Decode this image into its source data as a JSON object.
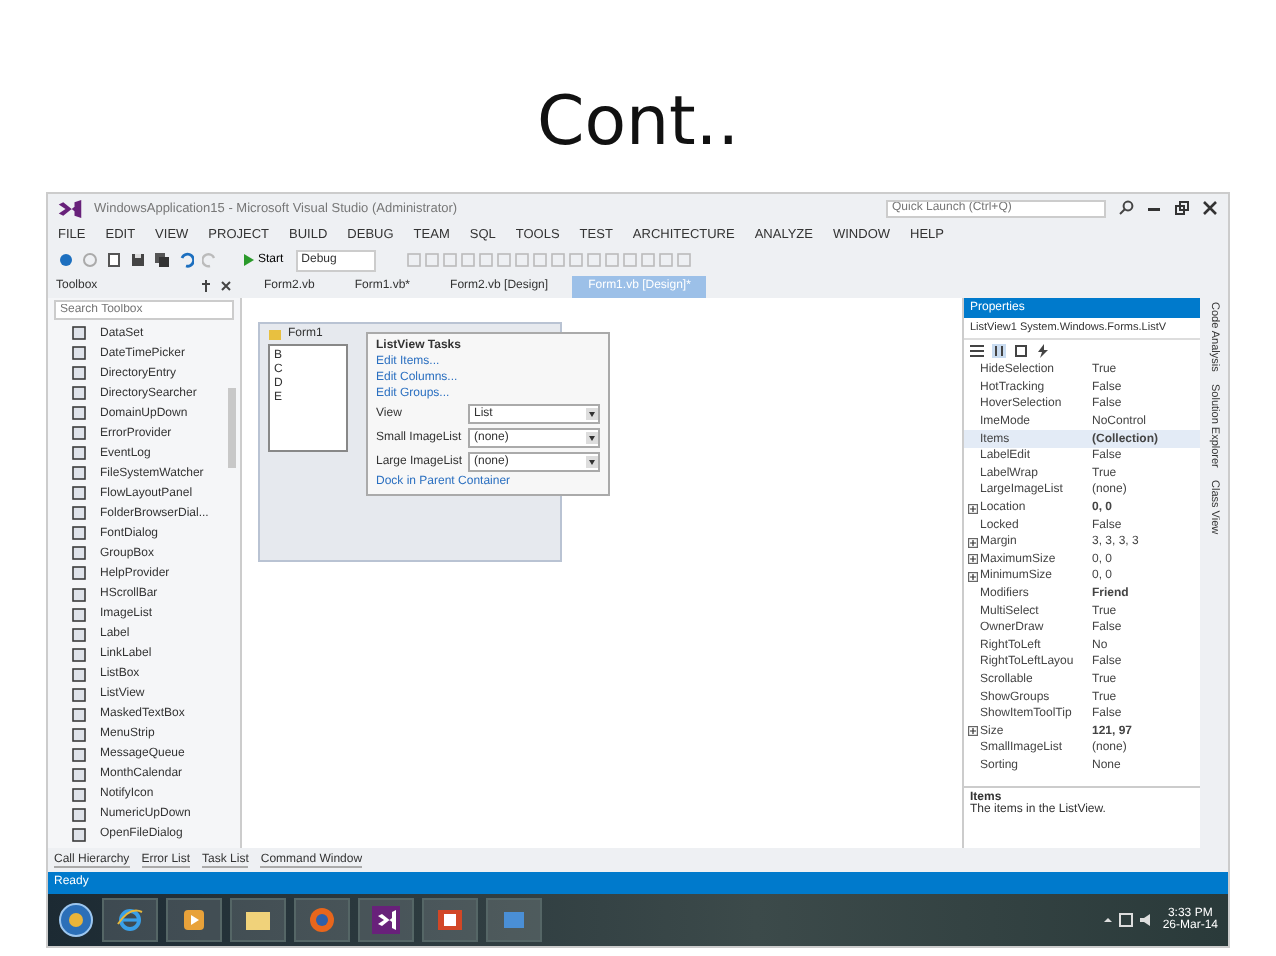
{
  "slide": {
    "title": "Cont.."
  },
  "window": {
    "title": "WindowsApplication15 - Microsoft Visual Studio (Administrator)",
    "quick_launch": {
      "placeholder": "Quick Launch (Ctrl+Q)"
    }
  },
  "menu": [
    "FILE",
    "EDIT",
    "VIEW",
    "PROJECT",
    "BUILD",
    "DEBUG",
    "TEAM",
    "SQL",
    "TOOLS",
    "TEST",
    "ARCHITECTURE",
    "ANALYZE",
    "WINDOW",
    "HELP"
  ],
  "toolbar": {
    "start": "Start",
    "config": "Debug"
  },
  "toolbox": {
    "title": "Toolbox",
    "search": {
      "placeholder": "Search Toolbox"
    },
    "items": [
      "DataSet",
      "DateTimePicker",
      "DirectoryEntry",
      "DirectorySearcher",
      "DomainUpDown",
      "ErrorProvider",
      "EventLog",
      "FileSystemWatcher",
      "FlowLayoutPanel",
      "FolderBrowserDial...",
      "FontDialog",
      "GroupBox",
      "HelpProvider",
      "HScrollBar",
      "ImageList",
      "Label",
      "LinkLabel",
      "ListBox",
      "ListView",
      "MaskedTextBox",
      "MenuStrip",
      "MessageQueue",
      "MonthCalendar",
      "NotifyIcon",
      "NumericUpDown",
      "OpenFileDialog"
    ]
  },
  "doc_tabs": [
    {
      "label": "Form2.vb",
      "selected": false
    },
    {
      "label": "Form1.vb*",
      "selected": false
    },
    {
      "label": "Form2.vb [Design]",
      "selected": false
    },
    {
      "label": "Form1.vb [Design]*",
      "selected": true
    }
  ],
  "designer": {
    "form_title": "Form1",
    "list_items": [
      "B",
      "C",
      "D",
      "E"
    ],
    "tasks": {
      "title": "ListView Tasks",
      "links": [
        "Edit Items...",
        "Edit Columns...",
        "Edit Groups..."
      ],
      "fields": [
        {
          "label": "View",
          "value": "List"
        },
        {
          "label": "Small ImageList",
          "value": "(none)"
        },
        {
          "label": "Large ImageList",
          "value": "(none)"
        }
      ],
      "dock_link": "Dock in Parent Container"
    }
  },
  "properties": {
    "title": "Properties",
    "object": "ListView1 System.Windows.Forms.ListV",
    "rows": [
      {
        "name": "HideSelection",
        "value": "True",
        "expandable": false,
        "bold": false,
        "selected": false
      },
      {
        "name": "HotTracking",
        "value": "False",
        "expandable": false,
        "bold": false,
        "selected": false
      },
      {
        "name": "HoverSelection",
        "value": "False",
        "expandable": false,
        "bold": false,
        "selected": false
      },
      {
        "name": "ImeMode",
        "value": "NoControl",
        "expandable": false,
        "bold": false,
        "selected": false
      },
      {
        "name": "Items",
        "value": "(Collection)",
        "expandable": false,
        "bold": true,
        "selected": true
      },
      {
        "name": "LabelEdit",
        "value": "False",
        "expandable": false,
        "bold": false,
        "selected": false
      },
      {
        "name": "LabelWrap",
        "value": "True",
        "expandable": false,
        "bold": false,
        "selected": false
      },
      {
        "name": "LargeImageList",
        "value": "(none)",
        "expandable": false,
        "bold": false,
        "selected": false
      },
      {
        "name": "Location",
        "value": "0, 0",
        "expandable": true,
        "bold": true,
        "selected": false
      },
      {
        "name": "Locked",
        "value": "False",
        "expandable": false,
        "bold": false,
        "selected": false
      },
      {
        "name": "Margin",
        "value": "3, 3, 3, 3",
        "expandable": true,
        "bold": false,
        "selected": false
      },
      {
        "name": "MaximumSize",
        "value": "0, 0",
        "expandable": true,
        "bold": false,
        "selected": false
      },
      {
        "name": "MinimumSize",
        "value": "0, 0",
        "expandable": true,
        "bold": false,
        "selected": false
      },
      {
        "name": "Modifiers",
        "value": "Friend",
        "expandable": false,
        "bold": true,
        "selected": false
      },
      {
        "name": "MultiSelect",
        "value": "True",
        "expandable": false,
        "bold": false,
        "selected": false
      },
      {
        "name": "OwnerDraw",
        "value": "False",
        "expandable": false,
        "bold": false,
        "selected": false
      },
      {
        "name": "RightToLeft",
        "value": "No",
        "expandable": false,
        "bold": false,
        "selected": false
      },
      {
        "name": "RightToLeftLayou",
        "value": "False",
        "expandable": false,
        "bold": false,
        "selected": false
      },
      {
        "name": "Scrollable",
        "value": "True",
        "expandable": false,
        "bold": false,
        "selected": false
      },
      {
        "name": "ShowGroups",
        "value": "True",
        "expandable": false,
        "bold": false,
        "selected": false
      },
      {
        "name": "ShowItemToolTip",
        "value": "False",
        "expandable": false,
        "bold": false,
        "selected": false
      },
      {
        "name": "Size",
        "value": "121, 97",
        "expandable": true,
        "bold": true,
        "selected": false
      },
      {
        "name": "SmallImageList",
        "value": "(none)",
        "expandable": false,
        "bold": false,
        "selected": false
      },
      {
        "name": "Sorting",
        "value": "None",
        "expandable": false,
        "bold": false,
        "selected": false
      }
    ],
    "desc_title": "Items",
    "desc_text": "The items in the ListView."
  },
  "side_tabs": [
    "Code Analysis",
    "Solution Explorer",
    "Class View"
  ],
  "bottom_tabs": [
    "Call Hierarchy",
    "Error List",
    "Task List",
    "Command Window"
  ],
  "status": "Ready",
  "taskbar": {
    "apps": [
      {
        "kind": "ie"
      },
      {
        "kind": "media"
      },
      {
        "kind": "folder"
      },
      {
        "kind": "firefox"
      },
      {
        "kind": "vs"
      },
      {
        "kind": "powerpoint"
      },
      {
        "kind": "generic"
      }
    ],
    "time": "3:33 PM",
    "date": "26-Mar-14"
  }
}
